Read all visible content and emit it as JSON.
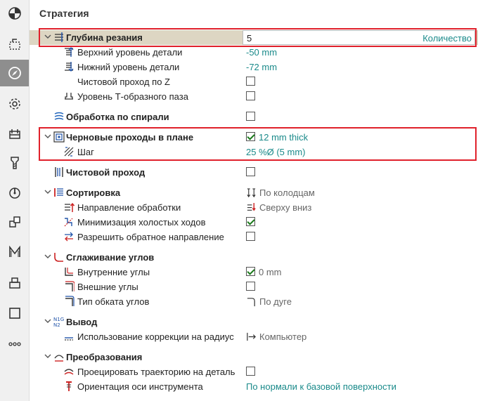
{
  "sidebar": {
    "items": [
      {
        "icon": "stock-origin-icon"
      },
      {
        "icon": "boundary-icon"
      },
      {
        "icon": "compass-icon",
        "active": true
      },
      {
        "icon": "gear-icon"
      },
      {
        "icon": "toolpath-icon"
      },
      {
        "icon": "tool-icon"
      },
      {
        "icon": "feed-icon"
      },
      {
        "icon": "cubes-icon"
      },
      {
        "icon": "macro-icon"
      },
      {
        "icon": "machine-icon"
      },
      {
        "icon": "square-icon"
      },
      {
        "icon": "more-icon"
      }
    ]
  },
  "panel": {
    "title": "Стратегия"
  },
  "params": {
    "depth": {
      "label": "Глубина резания",
      "value": "5",
      "unit": "Количество"
    },
    "top_level": {
      "label": "Верхний уровень детали",
      "value": "-50 mm"
    },
    "bottom_level": {
      "label": "Нижний уровень детали",
      "value": "-72 mm"
    },
    "finish_z": {
      "label": "Чистовой проход по Z"
    },
    "t_slot": {
      "label": "Уровень Т-образного паза"
    },
    "spiral": {
      "label": "Обработка по спирали"
    },
    "rough": {
      "label": "Черновые проходы в плане",
      "value": "12 mm thick"
    },
    "step": {
      "label": "Шаг",
      "value": "25 %Ø (5 mm)"
    },
    "finish": {
      "label": "Чистовой проход"
    },
    "sort": {
      "label": "Сортировка",
      "value": "По колодцам"
    },
    "direction": {
      "label": "Направление обработки",
      "value": "Сверху вниз"
    },
    "minimize": {
      "label": "Минимизация холостых ходов"
    },
    "reverse": {
      "label": "Разрешить обратное направление"
    },
    "smoothing": {
      "label": "Сглаживание углов"
    },
    "inner": {
      "label": "Внутренние углы",
      "value": "0 mm"
    },
    "outer": {
      "label": "Внешние углы"
    },
    "corner_type": {
      "label": "Тип обката углов",
      "value": "По дуге"
    },
    "output": {
      "label": "Вывод"
    },
    "radius_comp": {
      "label": "Использование коррекции на радиус",
      "value": "Компьютер"
    },
    "transform": {
      "label": "Преобразования"
    },
    "project": {
      "label": "Проецировать траекторию на деталь"
    },
    "orientation": {
      "label": "Ориентация оси инструмента",
      "value": "По нормали к базовой поверхности"
    }
  },
  "colors": {
    "accent": "#1a8a8a",
    "highlight": "#ddd6c3",
    "annotation": "#e0212b"
  }
}
